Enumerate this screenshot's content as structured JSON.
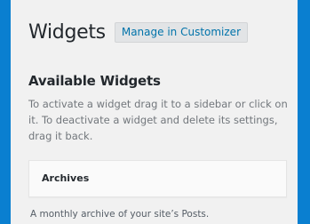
{
  "header": {
    "title": "Widgets",
    "manage_label": "Manage in Customizer"
  },
  "available": {
    "title": "Available Widgets",
    "description": "To activate a widget drag it to a sidebar or click on it. To deactivate a widget and delete its settings, drag it back."
  },
  "widgets": [
    {
      "title": "Archives",
      "description": "A monthly archive of your site’s Posts."
    }
  ],
  "colors": {
    "background": "#f1f1f1",
    "border": "#0a7fd0",
    "link": "#0073aa"
  }
}
